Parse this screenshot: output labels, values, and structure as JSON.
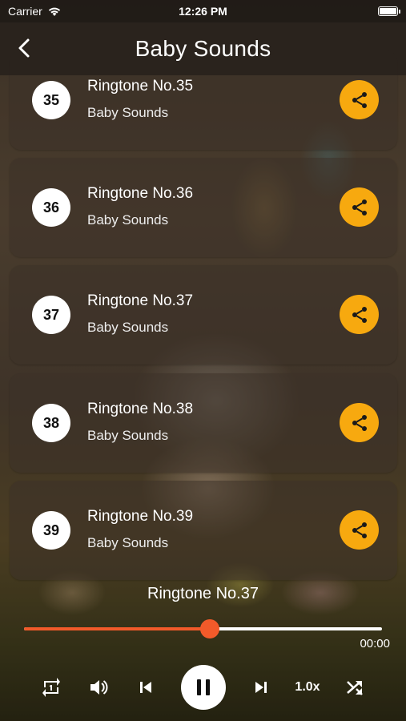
{
  "status_bar": {
    "carrier": "Carrier",
    "time": "12:26 PM"
  },
  "nav": {
    "title": "Baby Sounds",
    "back_icon": "chevron-left-icon"
  },
  "ringtones": [
    {
      "number": "35",
      "title": "Ringtone No.35",
      "subtitle": "Baby Sounds"
    },
    {
      "number": "36",
      "title": "Ringtone No.36",
      "subtitle": "Baby Sounds"
    },
    {
      "number": "37",
      "title": "Ringtone No.37",
      "subtitle": "Baby Sounds"
    },
    {
      "number": "38",
      "title": "Ringtone No.38",
      "subtitle": "Baby Sounds"
    },
    {
      "number": "39",
      "title": "Ringtone No.39",
      "subtitle": "Baby Sounds"
    }
  ],
  "player": {
    "now_playing": "Ringtone No.37",
    "progress_fraction": 0.52,
    "time": "00:00",
    "speed": "1.0x",
    "state": "playing"
  },
  "colors": {
    "accent_share": "#f7a90f",
    "progress_played": "#f25a2a",
    "progress_track": "#ffffff"
  },
  "icons": {
    "share": "share-icon",
    "repeat": "repeat-one-icon",
    "volume": "volume-icon",
    "previous": "skip-previous-icon",
    "pause": "pause-icon",
    "next": "skip-next-icon",
    "shuffle": "shuffle-icon"
  }
}
